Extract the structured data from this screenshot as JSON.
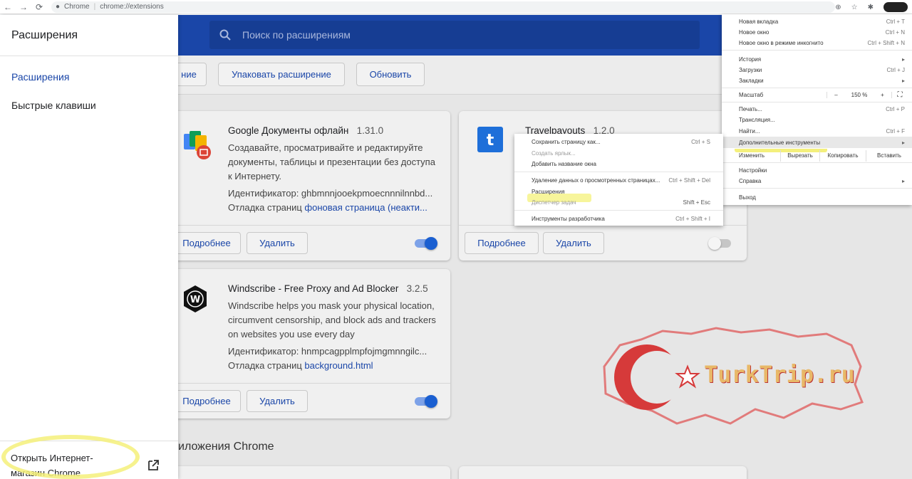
{
  "browser": {
    "tab_label": "Chrome",
    "url": "chrome://extensions"
  },
  "drawer": {
    "title": "Расширения",
    "nav": [
      "Расширения",
      "Быстрые клавиши"
    ],
    "store_link": "Открыть Интернет-магазин Chrome"
  },
  "header": {
    "search_placeholder": "Поиск по расширениям"
  },
  "toolbar": {
    "load_partial": "ние",
    "pack": "Упаковать расширение",
    "update": "Обновить"
  },
  "cards": [
    {
      "name": "Google Документы офлайн",
      "version": "1.31.0",
      "description": "Создавайте, просматривайте и редактируйте документы, таблицы и презентации без доступа к Интернету.",
      "id_line": "Идентификатор: ghbmnnjooekpmoecnnnilnnbd...",
      "inspect_prefix": "Отладка страниц ",
      "inspect_link": "фоновая страница (неакти...",
      "details": "Подробнее",
      "remove": "Удалить",
      "enabled": true
    },
    {
      "name": "Travelpayouts",
      "version": "1.2.0",
      "details": "Подробнее",
      "remove": "Удалить",
      "enabled": false
    },
    {
      "name": "Windscribe - Free Proxy and Ad Blocker",
      "version": "3.2.5",
      "description": "Windscribe helps you mask your physical location, circumvent censorship, and block ads and trackers on websites you use every day",
      "id_line": "Идентификатор: hnmpcagpplmpfojmgmnngilc...",
      "inspect_prefix": "Отладка страниц ",
      "inspect_link": "background.html",
      "details": "Подробнее",
      "remove": "Удалить",
      "enabled": true
    }
  ],
  "section_label": "иложения Chrome",
  "watermark": "TurkTrip.ru",
  "menu": {
    "new_tab": "Новая вкладка",
    "new_tab_sc": "Ctrl + T",
    "new_window": "Новое окно",
    "new_window_sc": "Ctrl + N",
    "incognito": "Новое окно в режиме инкогнито",
    "incognito_sc": "Ctrl + Shift + N",
    "history": "История",
    "downloads": "Загрузки",
    "downloads_sc": "Ctrl + J",
    "bookmarks": "Закладки",
    "zoom": "Масштаб",
    "zoom_minus": "–",
    "zoom_value": "150 %",
    "zoom_plus": "+",
    "print": "Печать...",
    "print_sc": "Ctrl + P",
    "cast": "Трансляция...",
    "find": "Найти...",
    "find_sc": "Ctrl + F",
    "more_tools": "Дополнительные инструменты",
    "edit": "Изменить",
    "cut": "Вырезать",
    "copy": "Копировать",
    "paste": "Вставить",
    "settings": "Настройки",
    "help": "Справка",
    "exit": "Выход"
  },
  "submenu": {
    "save_page": "Сохранить страницу как...",
    "save_page_sc": "Ctrl + S",
    "create_shortcut": "Создать ярлык...",
    "name_window": "Добавить название окна",
    "clear_data": "Удаление данных о просмотренных страницах...",
    "clear_data_sc": "Ctrl + Shift + Del",
    "extensions": "Расширения",
    "task_manager": "Диспетчер задач",
    "task_manager_sc": "Shift + Esc",
    "devtools": "Инструменты разработчика",
    "devtools_sc": "Ctrl + Shift + I"
  }
}
